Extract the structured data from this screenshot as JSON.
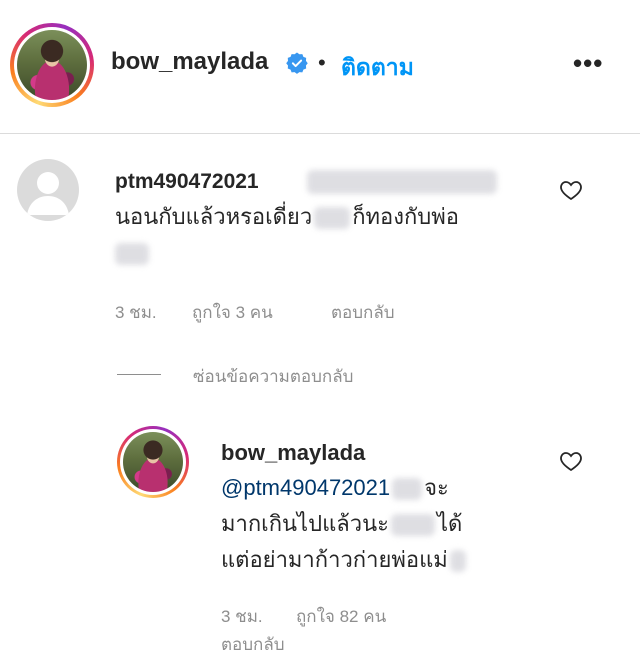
{
  "header": {
    "username": "bow_maylada",
    "dot": "•",
    "follow_label": "ติดตาม",
    "more_label": "•••"
  },
  "comment": {
    "username": "ptm490472021",
    "text_line1": "นอนกับแล้วหรอเดี่ยว",
    "text_line1_end": "ก็ทองกับพ่อ",
    "time": "3 ชม.",
    "likes": "ถูกใจ 3 คน",
    "reply_label": "ตอบกลับ"
  },
  "hide_replies_label": "ซ่อนข้อความตอบกลับ",
  "reply": {
    "username": "bow_maylada",
    "mention": "@ptm490472021",
    "text_line1_end": "จะ",
    "text_line2": "มากเกินไปแล้วนะ",
    "text_line2_end": "ได้",
    "text_line3": "แต่อย่ามาก้าวก่ายพ่อแม่",
    "time": "3 ชม.",
    "likes": "ถูกใจ 82 คน",
    "reply_label": "ตอบกลับ"
  },
  "icons": {
    "verified": "verified-badge-icon",
    "heart": "heart-outline-icon",
    "more": "more-options-icon"
  },
  "colors": {
    "link_blue": "#0095f6",
    "verified_blue": "#3897f0",
    "meta_gray": "#8e8e8e",
    "text": "#262626"
  }
}
